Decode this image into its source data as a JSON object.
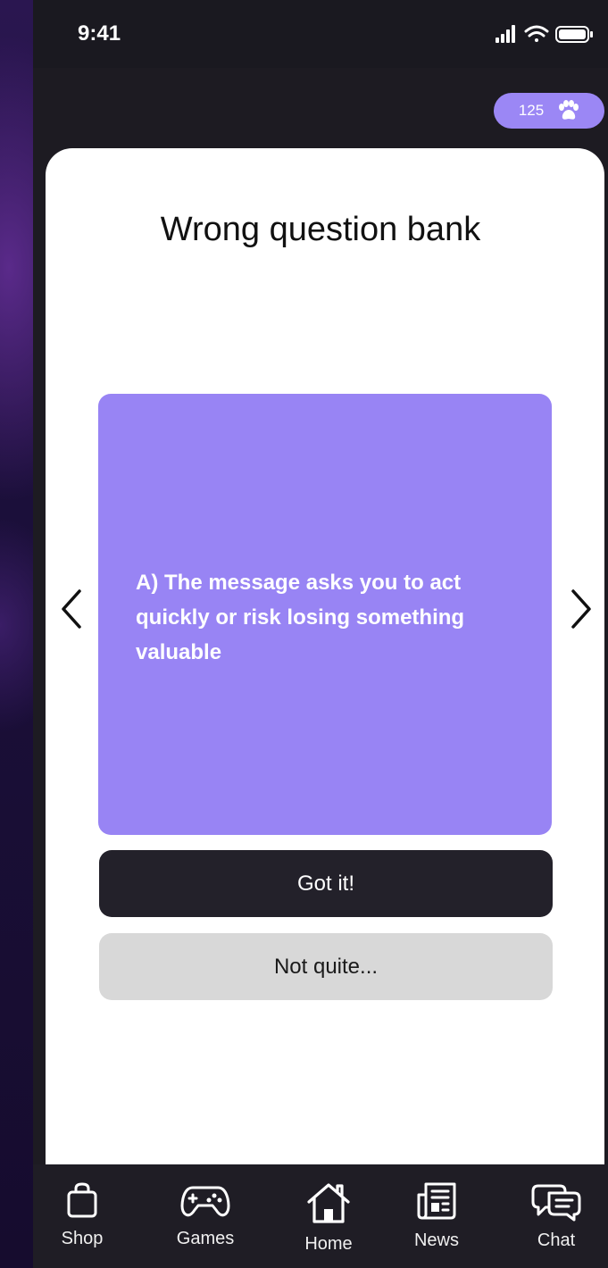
{
  "status_bar": {
    "time": "9:41"
  },
  "header": {
    "coin_count": "125",
    "coin_icon": "paw-icon"
  },
  "main": {
    "title": "Wrong question bank",
    "answer_text": "A) The message asks you to act quickly or risk losing something valuable",
    "got_it_label": "Got it!",
    "not_quite_label": "Not quite..."
  },
  "tab_bar": {
    "items": [
      {
        "label": "Shop",
        "icon": "shopping-bag-icon"
      },
      {
        "label": "Games",
        "icon": "gamepad-icon"
      },
      {
        "label": "Home",
        "icon": "home-icon"
      },
      {
        "label": "News",
        "icon": "newspaper-icon"
      },
      {
        "label": "Chat",
        "icon": "chat-icon"
      }
    ]
  },
  "colors": {
    "accent": "#9884f4",
    "dark": "#23212a",
    "light_button": "#d8d8d8",
    "background": "#1d1b22"
  }
}
